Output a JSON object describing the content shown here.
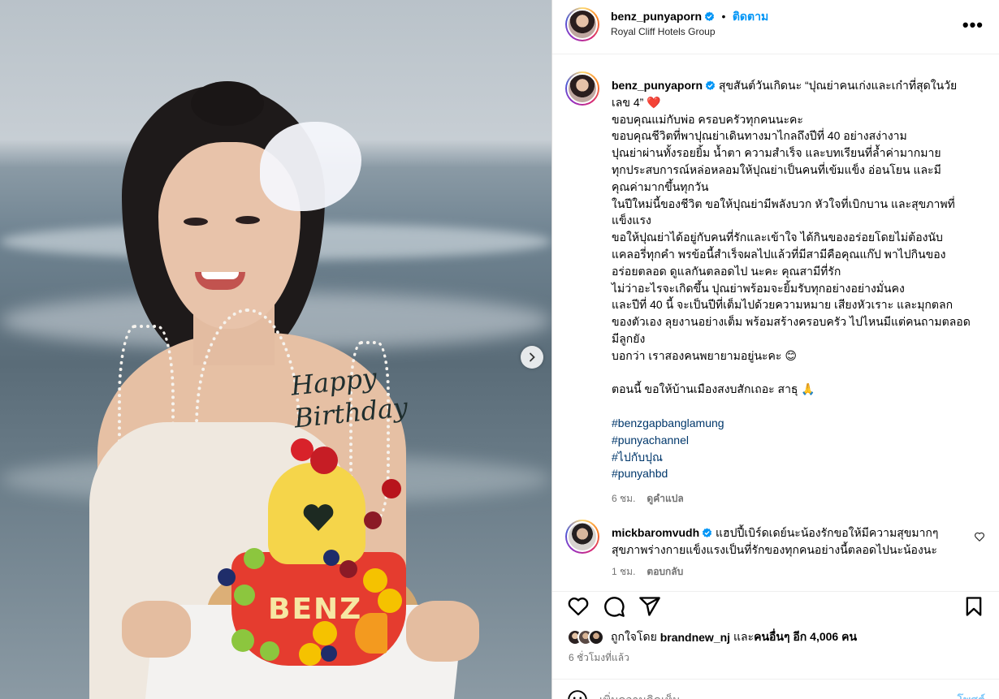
{
  "post": {
    "username": "benz_punyaporn",
    "follow_label": "ติดตาม",
    "dot": "•",
    "location": "Royal Cliff Hotels Group",
    "more_label": "•••",
    "photo_topper": "Happy Birthday",
    "cake_text": "BENZ"
  },
  "caption": {
    "username": "benz_punyaporn",
    "lines": [
      "สุขสันต์วันเกิดนะ “ปุณย่าคนเก่งและเก๋าที่สุดในวัย",
      "เลข 4” ❤️",
      "ขอบคุณแม่กับพ่อ ครอบครัวทุกคนนะคะ",
      "ขอบคุณชีวิตที่พาปุณย่าเดินทางมาไกลถึงปีที่ 40 อย่างสง่างาม",
      "ปุณย่าผ่านทั้งรอยยิ้ม น้ำตา ความสำเร็จ และบทเรียนที่ล้ำค่ามากมาย",
      "ทุกประสบการณ์หล่อหลอมให้ปุณย่าเป็นคนที่เข้มแข็ง อ่อนโยน และมี",
      "คุณค่ามากขึ้นทุกวัน",
      "ในปีใหม่นี้ของชีวิต ขอให้ปุณย่ามีพลังบวก หัวใจที่เบิกบาน และสุขภาพที่",
      "แข็งแรง",
      "ขอให้ปุณย่าได้อยู่กับคนที่รักและเข้าใจ ได้กินของอร่อยโดยไม่ต้องนับ",
      "แคลอรี่ทุกคำ พรข้อนี้สำเร็จผลไปแล้วที่มีสามีคือคุณแก๊ป พาไปกินของ",
      "อร่อยตลอด ดูแลกันตลอดไป นะคะ คุณสามีที่รัก",
      "ไม่ว่าอะไรจะเกิดขึ้น ปุณย่าพร้อมจะยิ้มรับทุกอย่างอย่างมั่นคง",
      "และปีที่ 40 นี้ จะเป็นปีที่เต็มไปด้วยความหมาย เสียงหัวเราะ และมุกตลก",
      "ของตัวเอง ลุยงานอย่างเต็ม พร้อมสร้างครอบครัว ไปไหนมีแต่คนถามตลอด",
      "มีลูกยัง",
      "บอกว่า เราสองคนพยายามอยู่นะคะ 😊",
      "",
      "ตอนนี้ ขอให้บ้านเมืองสงบสักเถอะ สาธุ 🙏"
    ],
    "hashtags": [
      "#benzgapbanglamung",
      "#punyachannel",
      "#ไปกับปุณ",
      "#punyahbd"
    ],
    "time": "6 ชม.",
    "translate_label": "ดูคำแปล"
  },
  "comment": {
    "username": "mickbaromvudh",
    "text_line1": "แฮปปี้เบิร์ดเดย์นะน้องรักขอให้มีความสุขมากๆ",
    "text_line2": "สุขภาพร่างกายแข็งแรงเป็นที่รักของทุกคนอย่างนี้ตลอดไปนะน้องนะ",
    "time": "1 ชม.",
    "reply_label": "ตอบกลับ"
  },
  "likes": {
    "prefix": "ถูกใจโดย",
    "user": "brandnew_nj",
    "middle": "และ",
    "others": "คนอื่นๆ อีก 4,006 คน"
  },
  "post_time": "6 ชั่วโมงที่แล้ว",
  "add_comment": {
    "placeholder": "เพิ่มความคิดเห็น...",
    "post_label": "โพสต์"
  },
  "colors": {
    "accent": "#0095f6",
    "hashtag": "#00376b",
    "verified": "#0095f6",
    "heart": "#ed1c24"
  }
}
